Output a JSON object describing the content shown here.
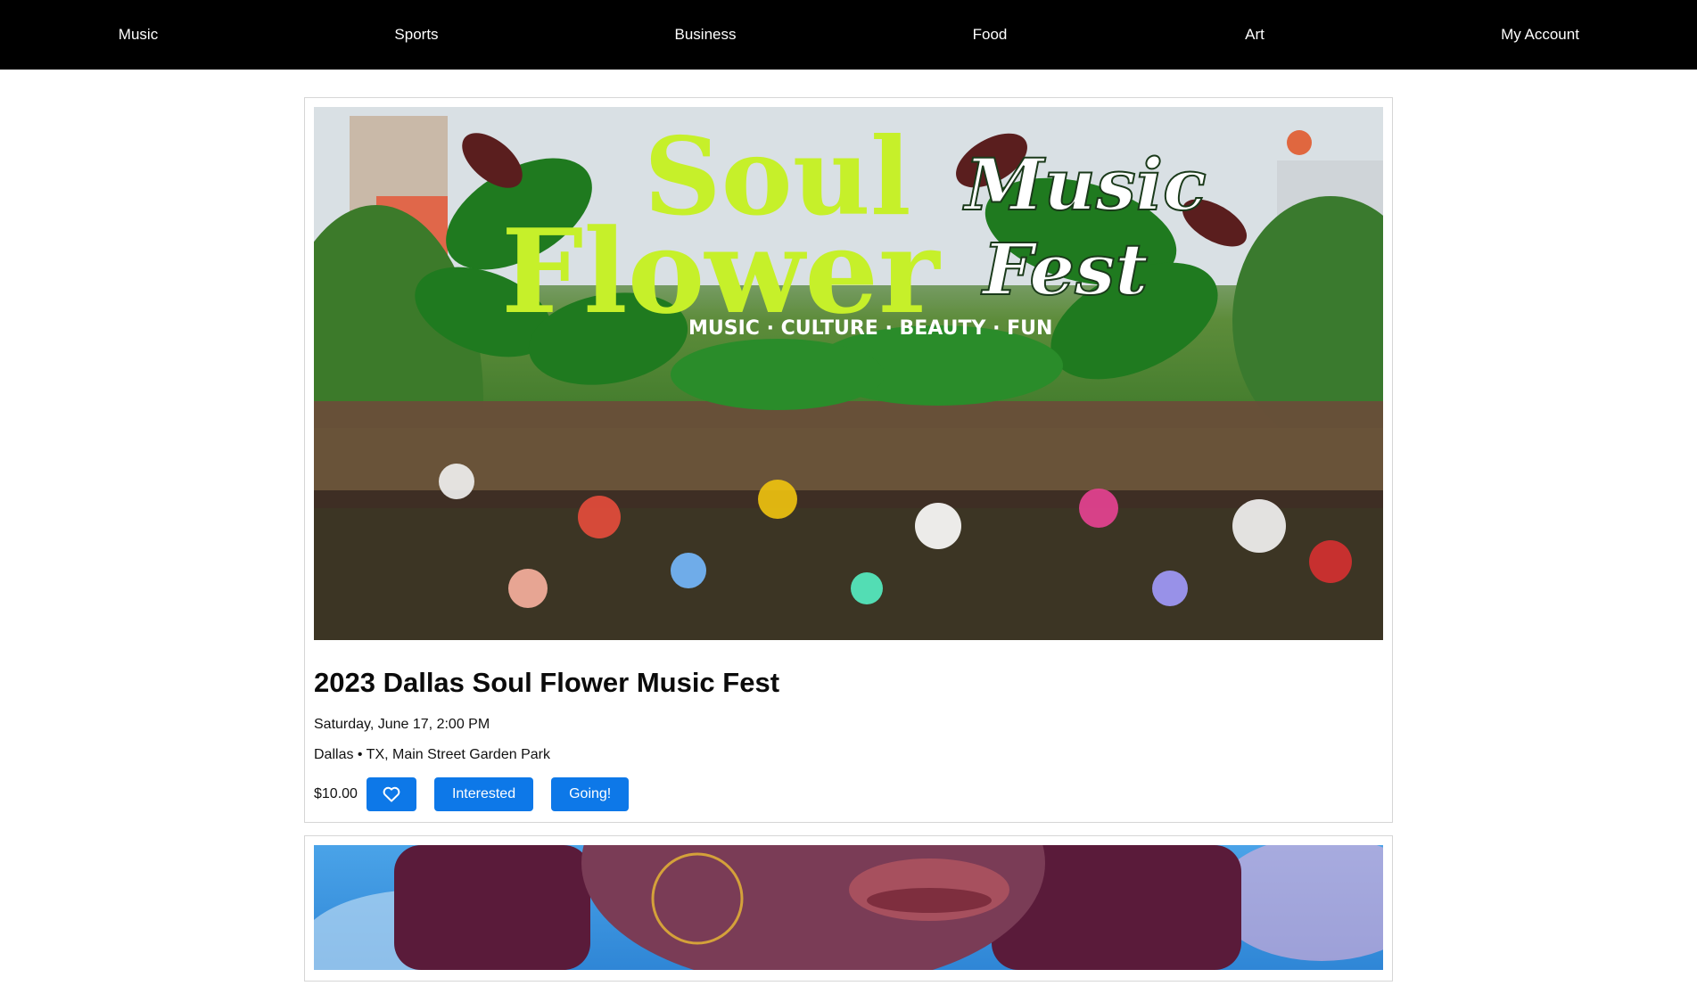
{
  "nav": {
    "items": [
      {
        "label": "Music"
      },
      {
        "label": "Sports"
      },
      {
        "label": "Business"
      },
      {
        "label": "Food"
      },
      {
        "label": "Art"
      },
      {
        "label": "My Account"
      }
    ]
  },
  "events": [
    {
      "banner": {
        "title_line1": "Soul",
        "title_line2": "Flower",
        "script_line1": "Music",
        "script_line2": "Fest",
        "tagline": "MUSIC · CULTURE · BEAUTY · FUN"
      },
      "title": "2023 Dallas Soul Flower Music Fest",
      "datetime": "Saturday, June 17, 2:00 PM",
      "location": "Dallas • TX, Main Street Garden Park",
      "price": "$10.00",
      "favorite_icon": "heart-icon",
      "interested_label": "Interested",
      "going_label": "Going!"
    }
  ],
  "colors": {
    "nav_bg": "#000000",
    "accent": "#0d78e8",
    "banner_green": "#c6f02a"
  }
}
